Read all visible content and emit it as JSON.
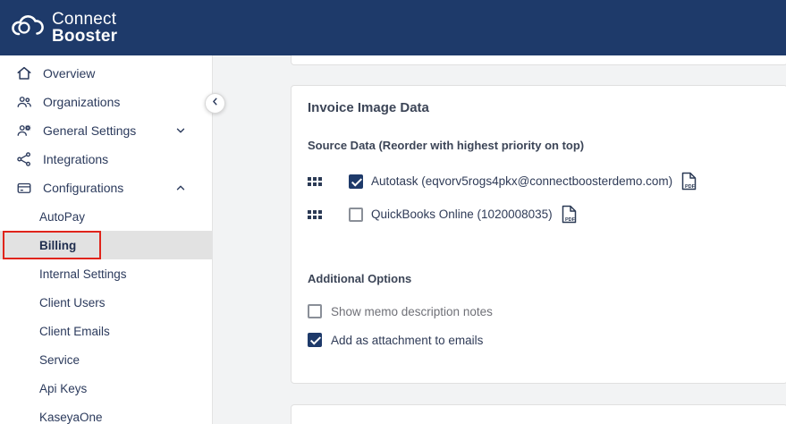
{
  "colors": {
    "brand_navy": "#1e3a6a",
    "annotation_red": "#e0241b",
    "selected_gray": "#e2e2e2"
  },
  "header": {
    "brand_line1": "Connect",
    "brand_line2": "Booster"
  },
  "sidebar": {
    "items": [
      {
        "label": "Overview",
        "icon": "home-icon"
      },
      {
        "label": "Organizations",
        "icon": "people-icon"
      },
      {
        "label": "General Settings",
        "icon": "people-gear-icon",
        "chevron": "down"
      },
      {
        "label": "Integrations",
        "icon": "integration-icon"
      },
      {
        "label": "Configurations",
        "icon": "billing-card-icon",
        "chevron": "up"
      }
    ],
    "sub_items": [
      {
        "label": "AutoPay",
        "selected": false
      },
      {
        "label": "Billing",
        "selected": true,
        "annotated": true
      },
      {
        "label": "Internal Settings",
        "selected": false
      },
      {
        "label": "Client Users",
        "selected": false
      },
      {
        "label": "Client Emails",
        "selected": false
      },
      {
        "label": "Service",
        "selected": false
      },
      {
        "label": "Api Keys",
        "selected": false
      },
      {
        "label": "KaseyaOne",
        "selected": false
      }
    ]
  },
  "main": {
    "card_title": "Invoice Image Data",
    "source_data_heading": "Source Data (Reorder with highest priority on top)",
    "pdf_label": "PDF",
    "sources": [
      {
        "label": "Autotask (eqvorv5rogs4pkx@connectboosterdemo.com)",
        "checked": true
      },
      {
        "label": "QuickBooks Online (1020008035)",
        "checked": false
      }
    ],
    "additional_options_heading": "Additional Options",
    "options": [
      {
        "label": "Show memo description notes",
        "checked": false
      },
      {
        "label": "Add as attachment to emails",
        "checked": true
      }
    ]
  }
}
